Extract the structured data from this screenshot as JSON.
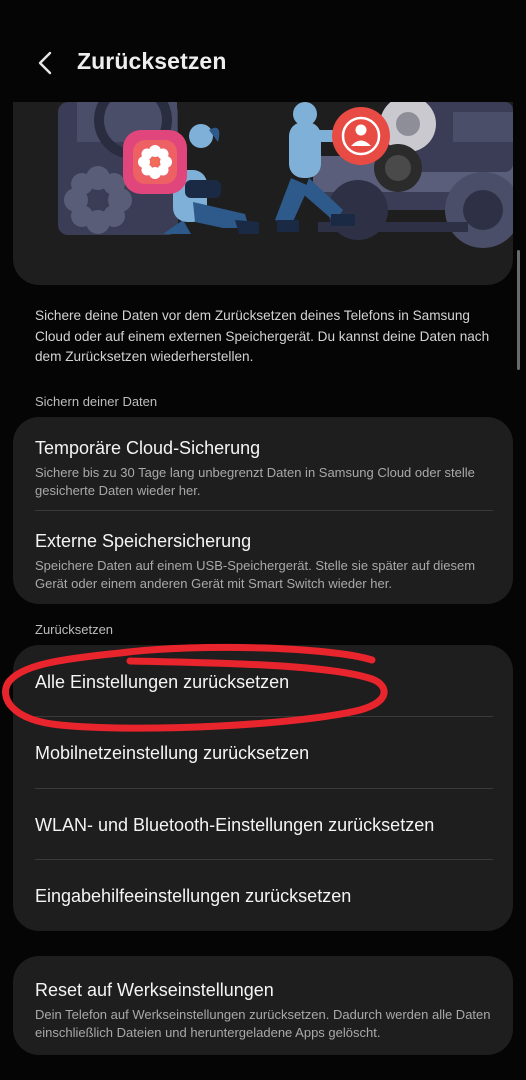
{
  "header": {
    "title": "Zurücksetzen",
    "back_icon": "chevron-left-icon"
  },
  "banner": {
    "icons": [
      "gallery-flower-icon",
      "account-person-icon"
    ]
  },
  "description": "Sichere deine Daten vor dem Zurücksetzen deines Telefons in Samsung Cloud oder auf einem externen Speichergerät. Du kannst deine Daten nach dem Zurücksetzen wiederherstellen.",
  "backup_section": {
    "label": "Sichern deiner Daten",
    "items": [
      {
        "title": "Temporäre Cloud-Sicherung",
        "subtitle": "Sichere bis zu 30 Tage lang unbegrenzt Daten in Samsung Cloud oder stelle gesicherte Daten wieder her."
      },
      {
        "title": "Externe Speichersicherung",
        "subtitle": "Speichere Daten auf einem USB-Speichergerät. Stelle sie später auf diesem Gerät oder einem anderen Gerät mit Smart Switch wieder her."
      }
    ]
  },
  "reset_section": {
    "label": "Zurücksetzen",
    "items": [
      {
        "title": "Alle Einstellungen zurücksetzen"
      },
      {
        "title": "Mobilnetzeinstellung zurücksetzen"
      },
      {
        "title": "WLAN- und Bluetooth-Einstellungen zurücksetzen"
      },
      {
        "title": "Eingabehilfeeinstellungen zurücksetzen"
      }
    ]
  },
  "factory_reset": {
    "title": "Reset auf Werkseinstellungen",
    "subtitle": "Dein Telefon auf Werkseinstellungen zurücksetzen. Dadurch werden alle Daten einschließlich Dateien und heruntergeladene Apps gelöscht."
  },
  "colors": {
    "background": "#050505",
    "card": "#1e1e1e",
    "annotation_red": "#e8242c",
    "gallery_gradient": "#e0457b",
    "account_red": "#e84a44"
  }
}
